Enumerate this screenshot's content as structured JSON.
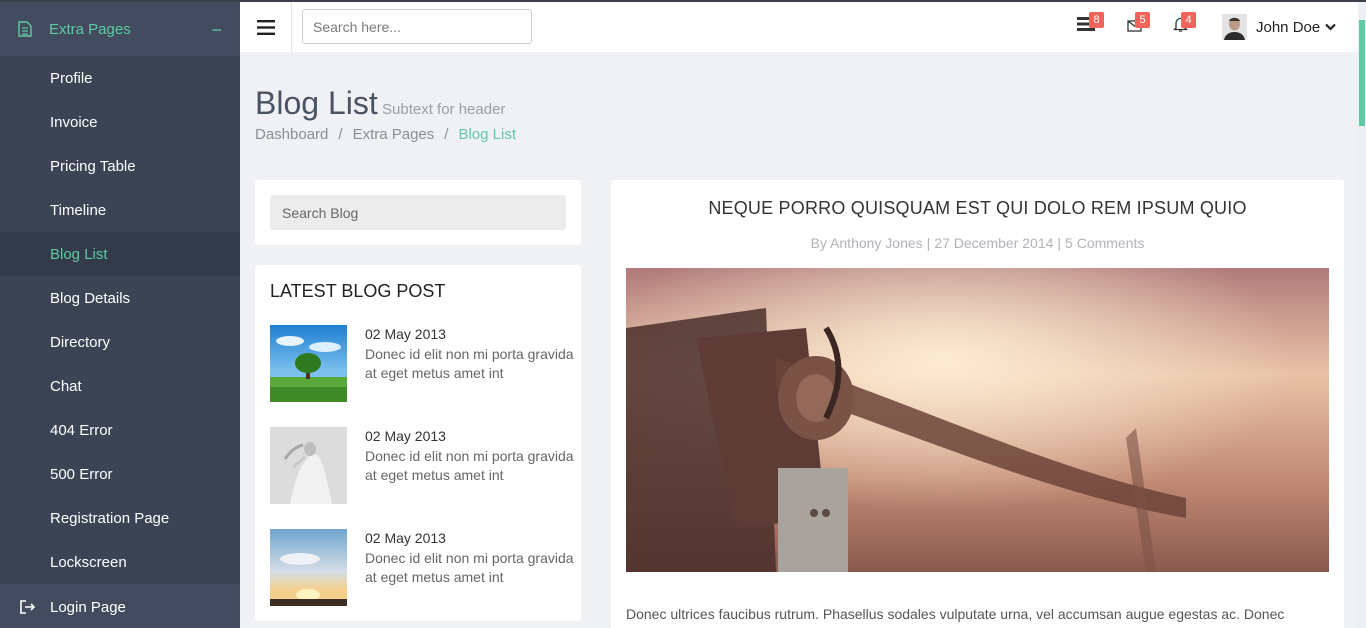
{
  "sidebar": {
    "section_label": "Extra Pages",
    "items": [
      {
        "label": "Profile"
      },
      {
        "label": "Invoice"
      },
      {
        "label": "Pricing Table"
      },
      {
        "label": "Timeline"
      },
      {
        "label": "Blog List"
      },
      {
        "label": "Blog Details"
      },
      {
        "label": "Directory"
      },
      {
        "label": "Chat"
      },
      {
        "label": "404 Error"
      },
      {
        "label": "500 Error"
      },
      {
        "label": "Registration Page"
      },
      {
        "label": "Lockscreen"
      }
    ],
    "active_item": "Blog List",
    "login_label": "Login Page"
  },
  "header": {
    "search_placeholder": "Search here...",
    "tasks_count": "8",
    "messages_count": "5",
    "notifications_count": "4",
    "user_name": "John Doe"
  },
  "page": {
    "title": "Blog List",
    "subtitle": "Subtext for header",
    "breadcrumb": [
      "Dashboard",
      "Extra Pages",
      "Blog List"
    ]
  },
  "blog_search": {
    "placeholder": "Search Blog"
  },
  "latest": {
    "title": "LATEST BLOG POST",
    "posts": [
      {
        "date": "02 May 2013",
        "text": "Donec id elit non mi porta gravida at eget metus amet int"
      },
      {
        "date": "02 May 2013",
        "text": "Donec id elit non mi porta gravida at eget metus amet int"
      },
      {
        "date": "02 May 2013",
        "text": "Donec id elit non mi porta gravida at eget metus amet int"
      }
    ]
  },
  "article": {
    "title": "NEQUE PORRO QUISQUAM EST QUI DOLO REM IPSUM QUIO",
    "author": "By Anthony Jones",
    "date": "27 December 2014",
    "comments": "5 Comments",
    "body": "Donec ultrices faucibus rutrum. Phasellus sodales vulputate urna, vel accumsan augue egestas ac. Donec"
  },
  "colors": {
    "accent": "#5fc9a4",
    "sidebar_bg": "#3b4455",
    "badge": "#f1645a"
  }
}
